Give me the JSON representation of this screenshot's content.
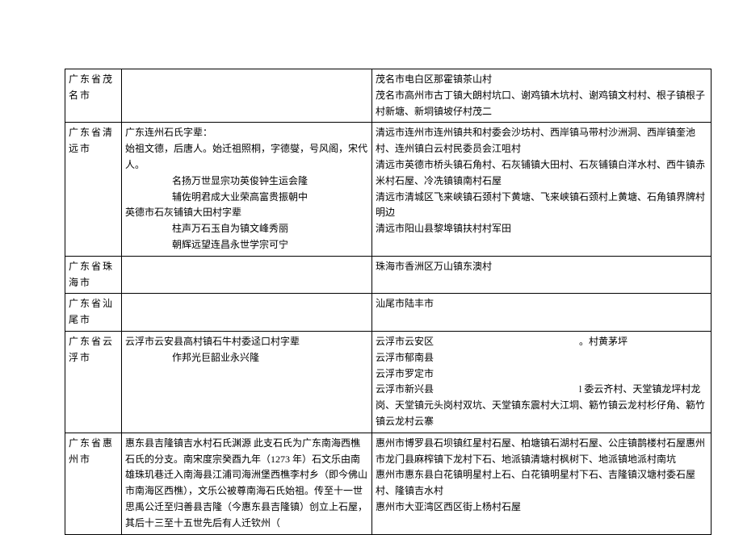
{
  "rows": [
    {
      "col1": "广东省茂名市",
      "col2": "",
      "col3": "茂名市电白区那霍镇茶山村\n茂名市高州市古丁镇大朗村坑口、谢鸡镇木坑村、谢鸡镇文村村、根子镇根子村新塘、新垌镇坡仔村茂二"
    },
    {
      "col1": "广东省清远市",
      "col2_lines": [
        "广东连州石氏字辈：",
        "始祖文德，后唐人。始迁祖照桐，字德燮，号风阁，宋代人。",
        {
          "indent": 1,
          "text": "名扬万世显宗功英俊钟生运会隆"
        },
        {
          "indent": 2,
          "text": "辅佐明君成大业荣高富贵振朝中"
        },
        "英德市石灰铺镇大田村字辈",
        {
          "indent": 1,
          "text": "柱声万石玉自为镇文峰秀丽"
        },
        {
          "indent": 2,
          "text": "朝辉远望连昌永世学宗可宁"
        }
      ],
      "col3": "清远市连州市连州镇共和村委会沙坊村、西岸镇马带村沙洲洞、西岸镇奎池村、连州镇白云村民委员会江咀村\n清远市英德市桥头镇石角村、石灰铺镇大田村、石灰铺镇白洋水村、西牛镇赤米村石屋、冷冼镇镇南村石屋\n清远市清城区飞来峡镇石颈村下黄塘、飞来峡镇石颈村上黄塘、石角镇界牌村明边\n清远市阳山县黎埠镇扶村村军田"
    },
    {
      "col1": "广东省珠海市",
      "col2": "",
      "col3": "珠海市香洲区万山镇东澳村"
    },
    {
      "col1": "广东省汕尾市",
      "col2": "",
      "col3": "汕尾市陆丰市"
    },
    {
      "col1": "广东省云浮市",
      "col2_lines": [
        "云浮市云安县高村镇石牛村委迳口村字辈",
        {
          "indent": 1,
          "text": "作邦光巨韶业永兴隆"
        }
      ],
      "col3": "云浮市云安区　　　　　　　　　　　　　　　。村黄茅坪\n云浮市郁南县\n云浮市罗定市\n云浮市新兴县　　　　　　　　　　　　　　　l 委云齐村、天堂镇龙坪村龙岗、天堂镇元头岗村双坑、天堂镇东震村大江垌、簕竹镇云龙村杉仔角、簕竹镇云龙村云寨"
    },
    {
      "col1": "广东省惠州市",
      "col2": "惠东县吉隆镇吉水村石氏渊源\n此支石氏为广东南海西樵石氏的分支。南宋度宗癸酉九年（1273 年）石文乐由南雄珠玑巷迁入南海县江浦司海洲堡西樵李村乡（即今佛山市南海区西樵），文乐公被尊南海石氏始祖。传至十一世思禹公迁至归善县吉隆（今惠东县吉隆镇）创立上石屋，其后十三至十五世先后有人迁钦州（",
      "col3": "惠州市博罗县石坝镇红星村石屋、柏塘镇石湖村石屋、公庄镇鹊楼村石屋惠州市龙门县麻榨镇下龙村下石、地派镇清塘村枫树下、地派镇地派村南坑\n惠州市惠东县白花镇明星村上石、白花镇明星村下石、吉隆镇汉塘村委石屋村、隆镇吉水村\n惠州市大亚湾区西区街上杨村石屋"
    }
  ]
}
